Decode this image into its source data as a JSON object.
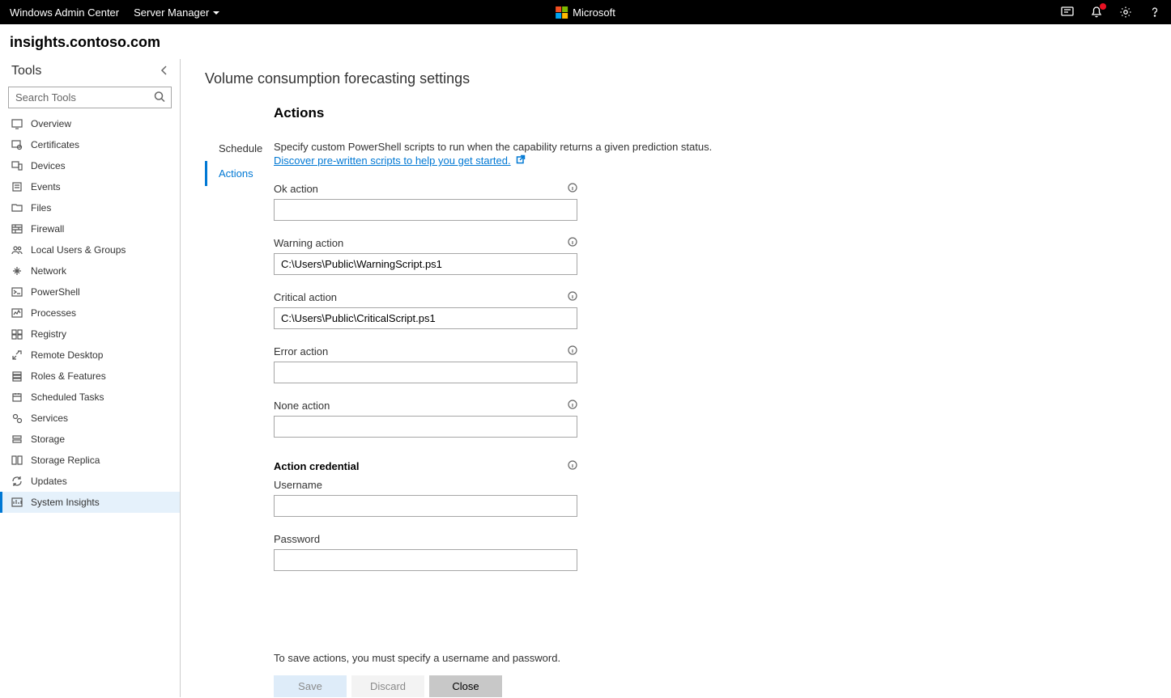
{
  "header": {
    "app_name": "Windows Admin Center",
    "dropdown_label": "Server Manager",
    "brand": "Microsoft"
  },
  "server_name": "insights.contoso.com",
  "sidebar": {
    "title": "Tools",
    "search_placeholder": "Search Tools",
    "items": [
      {
        "label": "Overview"
      },
      {
        "label": "Certificates"
      },
      {
        "label": "Devices"
      },
      {
        "label": "Events"
      },
      {
        "label": "Files"
      },
      {
        "label": "Firewall"
      },
      {
        "label": "Local Users & Groups"
      },
      {
        "label": "Network"
      },
      {
        "label": "PowerShell"
      },
      {
        "label": "Processes"
      },
      {
        "label": "Registry"
      },
      {
        "label": "Remote Desktop"
      },
      {
        "label": "Roles & Features"
      },
      {
        "label": "Scheduled Tasks"
      },
      {
        "label": "Services"
      },
      {
        "label": "Storage"
      },
      {
        "label": "Storage Replica"
      },
      {
        "label": "Updates"
      },
      {
        "label": "System Insights"
      }
    ]
  },
  "page": {
    "title": "Volume consumption forecasting settings",
    "nav": {
      "schedule": "Schedule",
      "actions": "Actions"
    },
    "heading": "Actions",
    "description": "Specify custom PowerShell scripts to run when the capability returns a given prediction status.",
    "link_text": "Discover pre-written scripts to help you get started.",
    "fields": {
      "ok": {
        "label": "Ok action",
        "value": ""
      },
      "warning": {
        "label": "Warning action",
        "value": "C:\\Users\\Public\\WarningScript.ps1"
      },
      "critical": {
        "label": "Critical action",
        "value": "C:\\Users\\Public\\CriticalScript.ps1"
      },
      "error": {
        "label": "Error action",
        "value": ""
      },
      "none": {
        "label": "None action",
        "value": ""
      }
    },
    "credential": {
      "heading": "Action credential",
      "username_label": "Username",
      "username_value": "",
      "password_label": "Password",
      "password_value": ""
    },
    "footer_note": "To save actions, you must specify a username and password.",
    "buttons": {
      "save": "Save",
      "discard": "Discard",
      "close": "Close"
    }
  }
}
